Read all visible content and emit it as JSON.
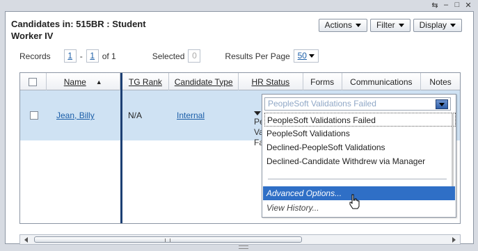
{
  "window": {
    "icons": [
      "restore-icon",
      "minimize-icon",
      "maximize-icon",
      "close-icon"
    ]
  },
  "header": {
    "title_line1": "Candidates in: 515BR : Student",
    "title_line2": "Worker IV",
    "actions_label": "Actions",
    "filter_label": "Filter",
    "display_label": "Display"
  },
  "paging": {
    "records_label": "Records",
    "from": "1",
    "dash": "-",
    "to": "1",
    "of_text": "of 1",
    "selected_label": "Selected",
    "selected_count": "0",
    "rpp_label": "Results Per Page",
    "rpp_value": "50"
  },
  "table": {
    "columns": [
      "Name",
      "TG Rank",
      "Candidate Type",
      "HR Status",
      "Forms",
      "Communications",
      "Notes"
    ],
    "rows": [
      {
        "name": "Jean, Billy",
        "tg_rank": "N/A",
        "candidate_type": "Internal",
        "hr_status_lines": [
          "Pe",
          "Va",
          "Fa"
        ]
      }
    ]
  },
  "status_dropdown": {
    "selected": "PeopleSoft Validations Failed",
    "options": [
      "PeopleSoft Validations Failed",
      "PeopleSoft Validations",
      "Declined-PeopleSoft Validations",
      "Declined-Candidate Withdrew via Manager"
    ],
    "advanced": "Advanced Options...",
    "history": "View History..."
  },
  "colors": {
    "row_selected": "#cfe2f3",
    "link": "#1b5ea8",
    "highlight": "#2f6fc6",
    "separator": "#1c3f73"
  }
}
